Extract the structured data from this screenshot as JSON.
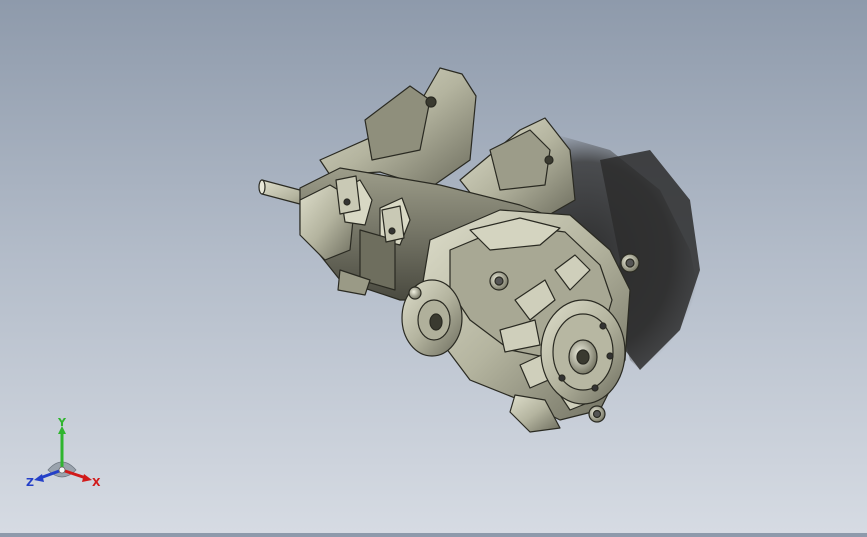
{
  "triad": {
    "x_label": "X",
    "y_label": "Y",
    "z_label": "Z",
    "x_color": "#d11a1a",
    "y_color": "#2fb52f",
    "z_color": "#2440c8"
  },
  "model": {
    "body_color": "#bfbfaa",
    "edge_color": "#2a2a22",
    "shadow_color": "#2d2d2d"
  }
}
